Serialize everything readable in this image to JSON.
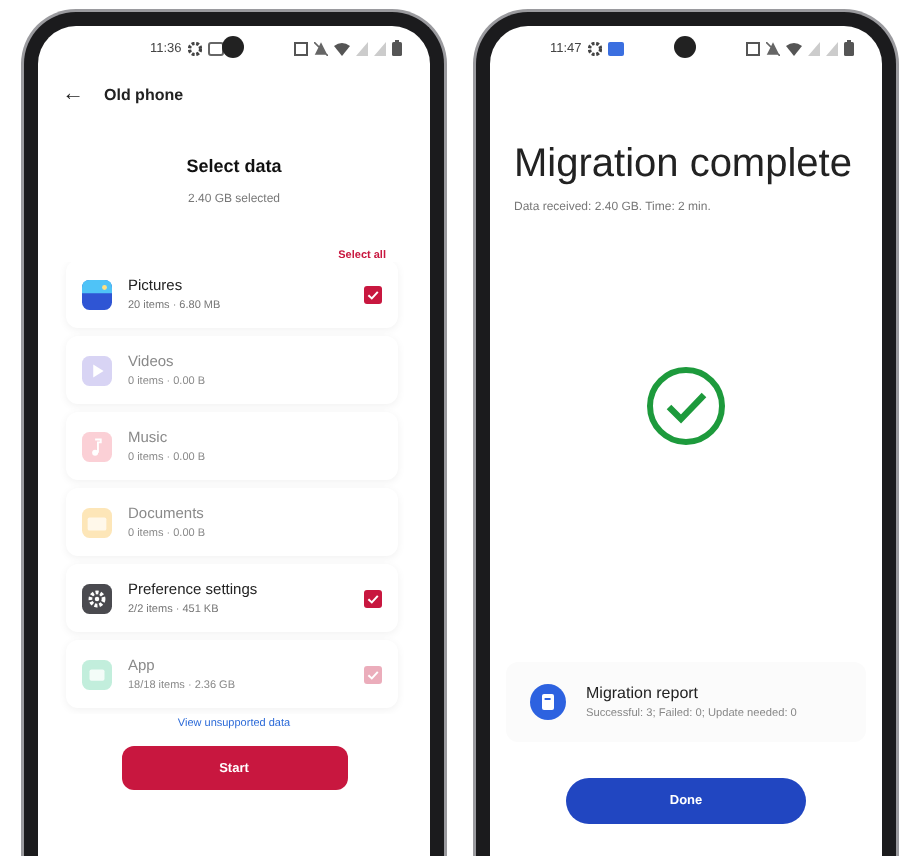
{
  "old_phone": {
    "status_bar": {
      "time": "11:36"
    },
    "header": {
      "back": "←",
      "title": "Old phone"
    },
    "heading": "Select data",
    "summary": "2.40 GB selected",
    "select_all": "Select all",
    "items": [
      {
        "name": "Pictures",
        "detail": "20 items · 6.80 MB",
        "kind": "pictures",
        "color": "#2f55d4",
        "disabled": false,
        "checked": true
      },
      {
        "name": "Videos",
        "detail": "0 items · 0.00 B",
        "kind": "videos",
        "color": "#d8d4f4",
        "disabled": true,
        "checked": false
      },
      {
        "name": "Music",
        "detail": "0 items · 0.00 B",
        "kind": "music",
        "color": "#fbd0d6",
        "disabled": true,
        "checked": false
      },
      {
        "name": "Documents",
        "detail": "0 items · 0.00 B",
        "kind": "documents",
        "color": "#fde6b8",
        "disabled": true,
        "checked": false
      },
      {
        "name": "Preference settings",
        "detail": "2/2 items · 451 KB",
        "kind": "settings",
        "color": "#4a4a4f",
        "disabled": false,
        "checked": true
      },
      {
        "name": "App",
        "detail": "18/18 items · 2.36 GB",
        "kind": "app",
        "color": "#c2eedc",
        "disabled": true,
        "checked": true
      }
    ],
    "link": "View unsupported data",
    "button": "Start"
  },
  "new_phone": {
    "status_bar": {
      "time": "11:47"
    },
    "title": "Migration complete",
    "subtitle": "Data received: 2.40  GB. Time: 2 min.",
    "report": {
      "title": "Migration report",
      "detail": "Successful: 3; Failed: 0; Update needed: 0"
    },
    "button": "Done"
  }
}
